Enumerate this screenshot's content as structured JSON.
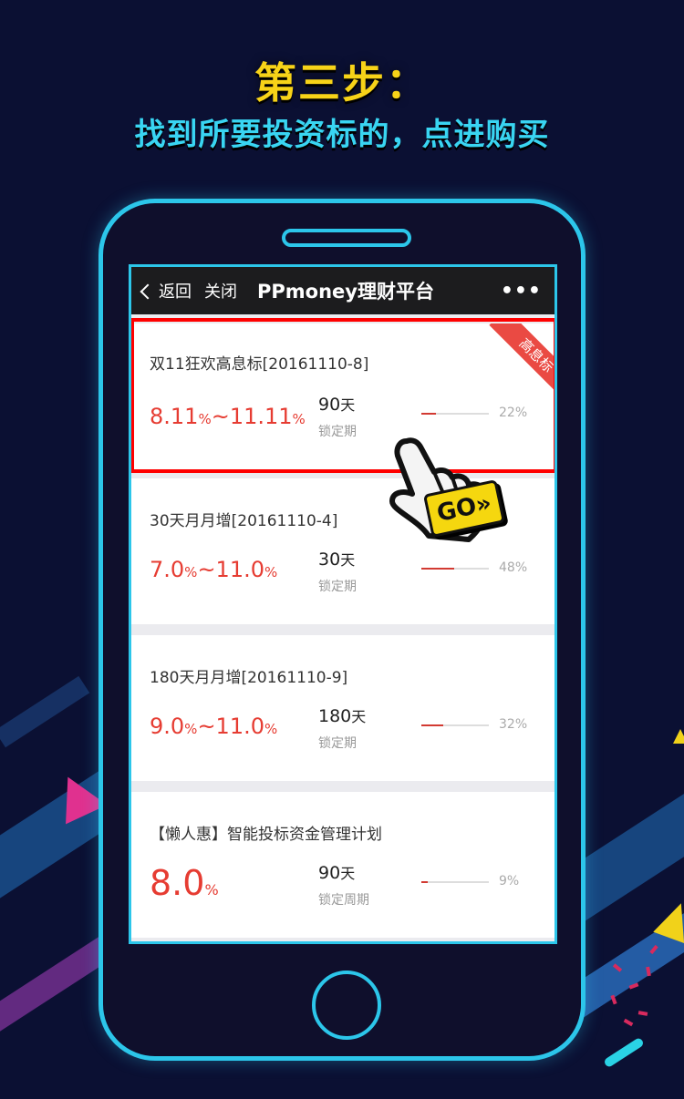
{
  "header": {
    "step_title": "第三步：",
    "step_subtitle": "找到所要投资标的，点进购买"
  },
  "navbar": {
    "back_label": "返回",
    "close_label": "关闭",
    "title": "PPmoney理财平台",
    "more_label": "•••"
  },
  "products": [
    {
      "title": "双11狂欢高息标[20161110-8]",
      "rate_low": "8.11",
      "rate_high": "11.11",
      "pct_symbol": "%",
      "separator": "~",
      "term_value": "90",
      "term_unit": "天",
      "term_label": "锁定期",
      "progress_text": "22%",
      "progress": 0.22,
      "ribbon": "高息标",
      "highlighted": true
    },
    {
      "title": "30天月月增[20161110-4]",
      "rate_low": "7.0",
      "rate_high": "11.0",
      "pct_symbol": "%",
      "separator": "~",
      "term_value": "30",
      "term_unit": "天",
      "term_label": "锁定期",
      "progress_text": "48%",
      "progress": 0.48
    },
    {
      "title": "180天月月增[20161110-9]",
      "rate_low": "9.0",
      "rate_high": "11.0",
      "pct_symbol": "%",
      "separator": "~",
      "term_value": "180",
      "term_unit": "天",
      "term_label": "锁定期",
      "progress_text": "32%",
      "progress": 0.32
    },
    {
      "title": "【懒人惠】智能投标资金管理计划",
      "rate_low": "8.0",
      "pct_symbol": "%",
      "term_value": "90",
      "term_unit": "天",
      "term_label": "锁定周期",
      "progress_text": "9%",
      "progress": 0.09
    }
  ],
  "go_badge": "GO»",
  "colors": {
    "background": "#0b1033",
    "accent_yellow": "#f7d318",
    "accent_cyan": "#39d5f2",
    "phone_frame": "#2cc6ea",
    "rate_red": "#e63c32",
    "highlight_red": "#ff0000"
  }
}
